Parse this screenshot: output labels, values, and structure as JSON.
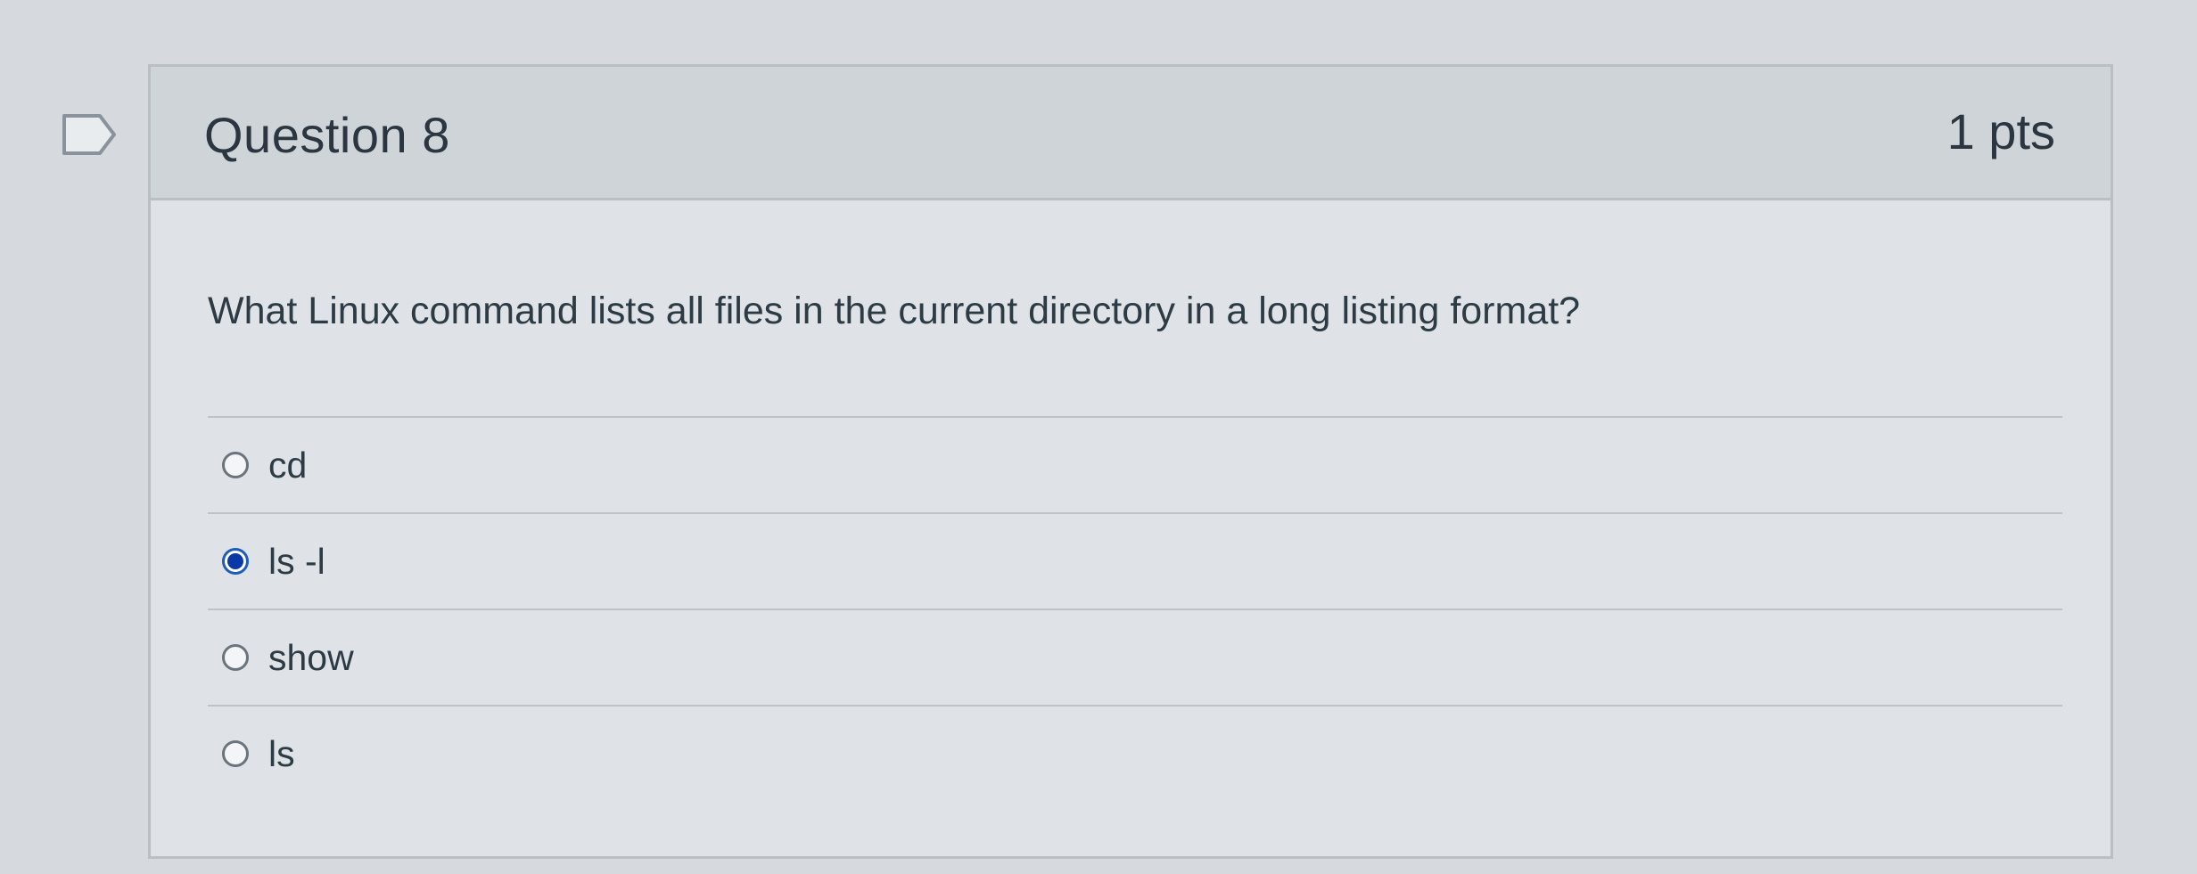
{
  "question": {
    "title": "Question 8",
    "points": "1 pts",
    "text": "What Linux command lists all files in the current directory in a long listing format?",
    "flag_icon": "flag-icon"
  },
  "answers": [
    {
      "label": "cd",
      "selected": false
    },
    {
      "label": "ls -l",
      "selected": true
    },
    {
      "label": "show",
      "selected": false
    },
    {
      "label": "ls",
      "selected": false
    }
  ],
  "colors": {
    "selected_radio": "#0b3aa8",
    "card_border": "#b9bfc5",
    "header_bg": "#cfd4d9"
  }
}
